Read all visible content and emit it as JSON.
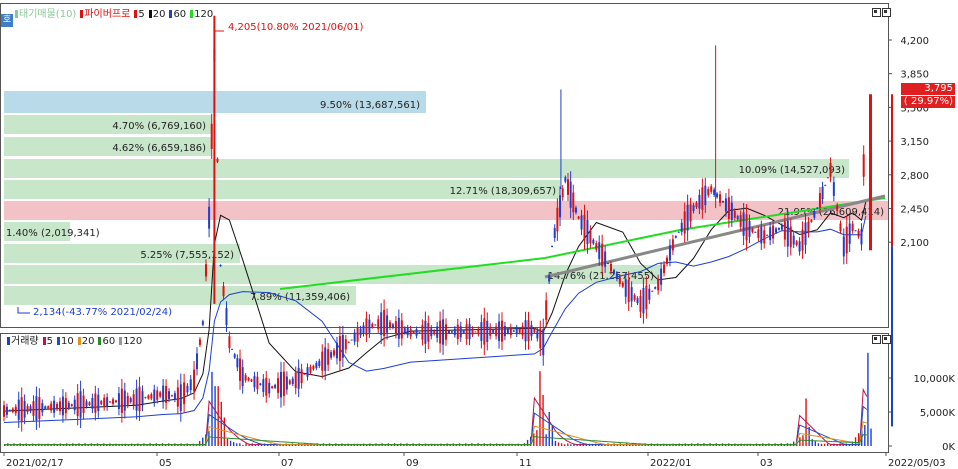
{
  "top_legend": {
    "tag": "호",
    "title": "태기매물(10)",
    "series_name": "파이버프로",
    "ma": [
      "5",
      "20",
      "60",
      "120"
    ]
  },
  "bottom_legend": {
    "title": "거래량",
    "ma": [
      "5",
      "10",
      "20",
      "60",
      "120"
    ]
  },
  "colors": {
    "up": "#e01010",
    "down": "#1c3fd0",
    "ma5": "#e01010",
    "ma20": "#111111",
    "ma60": "#1c3fd0",
    "ma120": "#22dd22",
    "trend": "#888888",
    "band_green": "#c8e6c9",
    "band_blue": "#b9dbe9",
    "band_red": "#f3c2c6",
    "vol_ma5": "#c01050",
    "vol_ma10": "#2050c0",
    "vol_ma20": "#e09020",
    "vol_ma60": "#2a8a2a",
    "vol_ma120": "#999999"
  },
  "annotations": {
    "high": "4,205(10.80% 2021/06/01)",
    "low": "2,134(-43.77% 2021/02/24)",
    "last_price": "3,795",
    "last_change": "( 29.97%)"
  },
  "volume_profile": [
    {
      "label": "9.50% (13,687,561)",
      "kind": "blue"
    },
    {
      "label": "4.70% (6,769,160)",
      "kind": "green"
    },
    {
      "label": "4.62% (6,659,186)",
      "kind": "green"
    },
    {
      "label": "10.09% (14,527,093)",
      "kind": "green"
    },
    {
      "label": "12.71% (18,309,657)",
      "kind": "green"
    },
    {
      "label": "21.95% (26,609,414)",
      "kind": "red"
    },
    {
      "label": "1.40% (2,019,341)",
      "kind": "green"
    },
    {
      "label": "5.25% (7,555,152)",
      "kind": "green"
    },
    {
      "label": "14.76% (21,257,455)",
      "kind": "green"
    },
    {
      "label": "7.89% (11,359,406)",
      "kind": "green"
    }
  ],
  "chart_data": [
    {
      "type": "candlestick",
      "name": "price",
      "y_ticks": [
        "4,200",
        "3,850",
        "3,500",
        "3,150",
        "2,800",
        "2,450",
        "2,100"
      ],
      "ylim": [
        2000,
        4300
      ],
      "x_labels": [
        "2021/02/17",
        "05",
        "07",
        "09",
        "11",
        "2022/01",
        "03",
        "2022/05/03"
      ],
      "high_point": {
        "date": "2021/06/01",
        "price": 4205
      },
      "low_point": {
        "date": "2021/02/24",
        "price": 2134
      },
      "last_price": 3795,
      "last_change_pct": 29.97,
      "close_path": [
        [
          0,
          2140
        ],
        [
          0.05,
          2160
        ],
        [
          0.1,
          2180
        ],
        [
          0.15,
          2200
        ],
        [
          0.18,
          2230
        ],
        [
          0.2,
          2210
        ],
        [
          0.215,
          2300
        ],
        [
          0.225,
          2600
        ],
        [
          0.232,
          3150
        ],
        [
          0.238,
          4000
        ],
        [
          0.245,
          2900
        ],
        [
          0.255,
          2500
        ],
        [
          0.27,
          2320
        ],
        [
          0.3,
          2260
        ],
        [
          0.33,
          2300
        ],
        [
          0.36,
          2400
        ],
        [
          0.39,
          2500
        ],
        [
          0.41,
          2580
        ],
        [
          0.43,
          2600
        ],
        [
          0.46,
          2550
        ],
        [
          0.6,
          2560
        ],
        [
          0.61,
          2500
        ],
        [
          0.62,
          3000
        ],
        [
          0.635,
          3350
        ],
        [
          0.65,
          3150
        ],
        [
          0.67,
          3000
        ],
        [
          0.7,
          2800
        ],
        [
          0.72,
          2700
        ],
        [
          0.74,
          2800
        ],
        [
          0.76,
          3050
        ],
        [
          0.78,
          3200
        ],
        [
          0.8,
          3300
        ],
        [
          0.82,
          3200
        ],
        [
          0.84,
          3100
        ],
        [
          0.86,
          3050
        ],
        [
          0.88,
          3100
        ],
        [
          0.9,
          3000
        ],
        [
          0.92,
          3200
        ],
        [
          0.935,
          3400
        ],
        [
          0.95,
          3000
        ],
        [
          0.96,
          3100
        ],
        [
          0.97,
          3050
        ],
        [
          0.975,
          3795
        ]
      ]
    },
    {
      "type": "bar",
      "name": "volume",
      "y_ticks": [
        "10,000K",
        "5,000K",
        "0K"
      ],
      "ylim": [
        0,
        14000
      ],
      "peaks": [
        [
          0.235,
          10900
        ],
        [
          0.24,
          8800
        ],
        [
          0.245,
          6500
        ],
        [
          0.25,
          4200
        ],
        [
          0.605,
          11000
        ],
        [
          0.61,
          7500
        ],
        [
          0.615,
          5000
        ],
        [
          0.62,
          3000
        ],
        [
          0.905,
          7000
        ],
        [
          0.91,
          2800
        ],
        [
          0.975,
          13700
        ]
      ]
    }
  ]
}
